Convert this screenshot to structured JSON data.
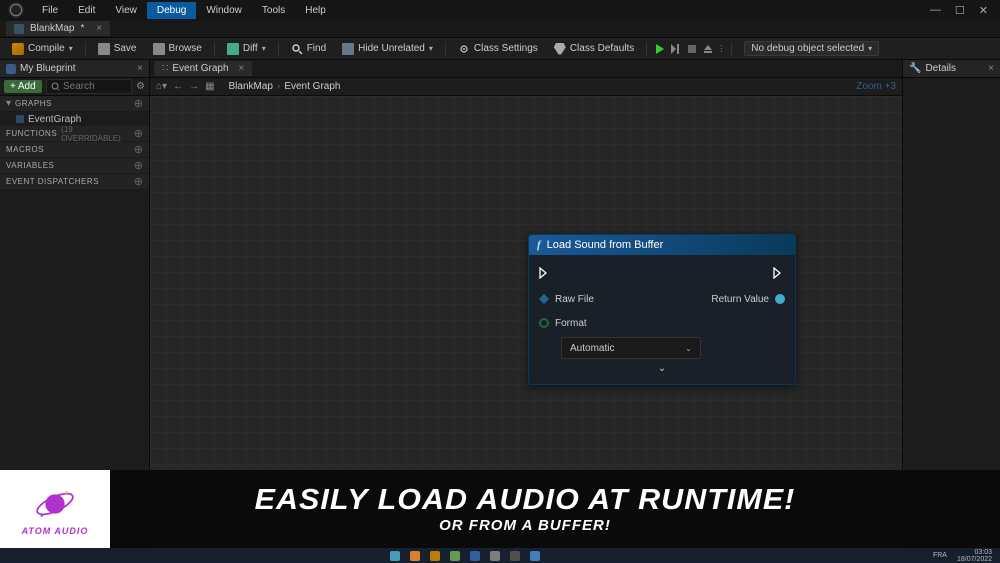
{
  "window": {
    "minimize": "—",
    "maximize": "☐",
    "close": "✕"
  },
  "menubar": {
    "items": [
      "File",
      "Edit",
      "View",
      "Debug",
      "Window",
      "Tools",
      "Help"
    ],
    "active_index": 3
  },
  "doc_tab": {
    "title": "BlankMap",
    "dirty": "*",
    "close": "×"
  },
  "toolbar": {
    "compile": "Compile",
    "save": "Save",
    "browse": "Browse",
    "diff": "Diff",
    "find": "Find",
    "hide_unrelated": "Hide Unrelated",
    "class_settings": "Class Settings",
    "class_defaults": "Class Defaults",
    "debug_selector": "No debug object selected"
  },
  "my_blueprint": {
    "title": "My Blueprint",
    "add": "Add",
    "search_placeholder": "Search",
    "categories": [
      {
        "label": "Graphs",
        "meta": "",
        "items": [
          "EventGraph"
        ]
      },
      {
        "label": "Functions",
        "meta": "(19 OVERRIDABLE)",
        "items": []
      },
      {
        "label": "Macros",
        "meta": "",
        "items": []
      },
      {
        "label": "Variables",
        "meta": "",
        "items": []
      },
      {
        "label": "Event Dispatchers",
        "meta": "",
        "items": []
      }
    ]
  },
  "graph": {
    "tab_label": "Event Graph",
    "breadcrumb": {
      "a": "BlankMap",
      "b": "Event Graph",
      "sep": "›"
    },
    "zoom": "Zoom +3"
  },
  "node": {
    "title": "Load Sound from Buffer",
    "raw_file": "Raw File",
    "return_value": "Return Value",
    "format_label": "Format",
    "format_value": "Automatic"
  },
  "details": {
    "title": "Details"
  },
  "banner": {
    "brand": "ATOM AUDIO",
    "line1": "Easily load audio at runtime!",
    "line2": "Or from a buffer!"
  },
  "taskbar": {
    "lang": "FRA",
    "time": "03:03",
    "date": "18/07/2022"
  }
}
